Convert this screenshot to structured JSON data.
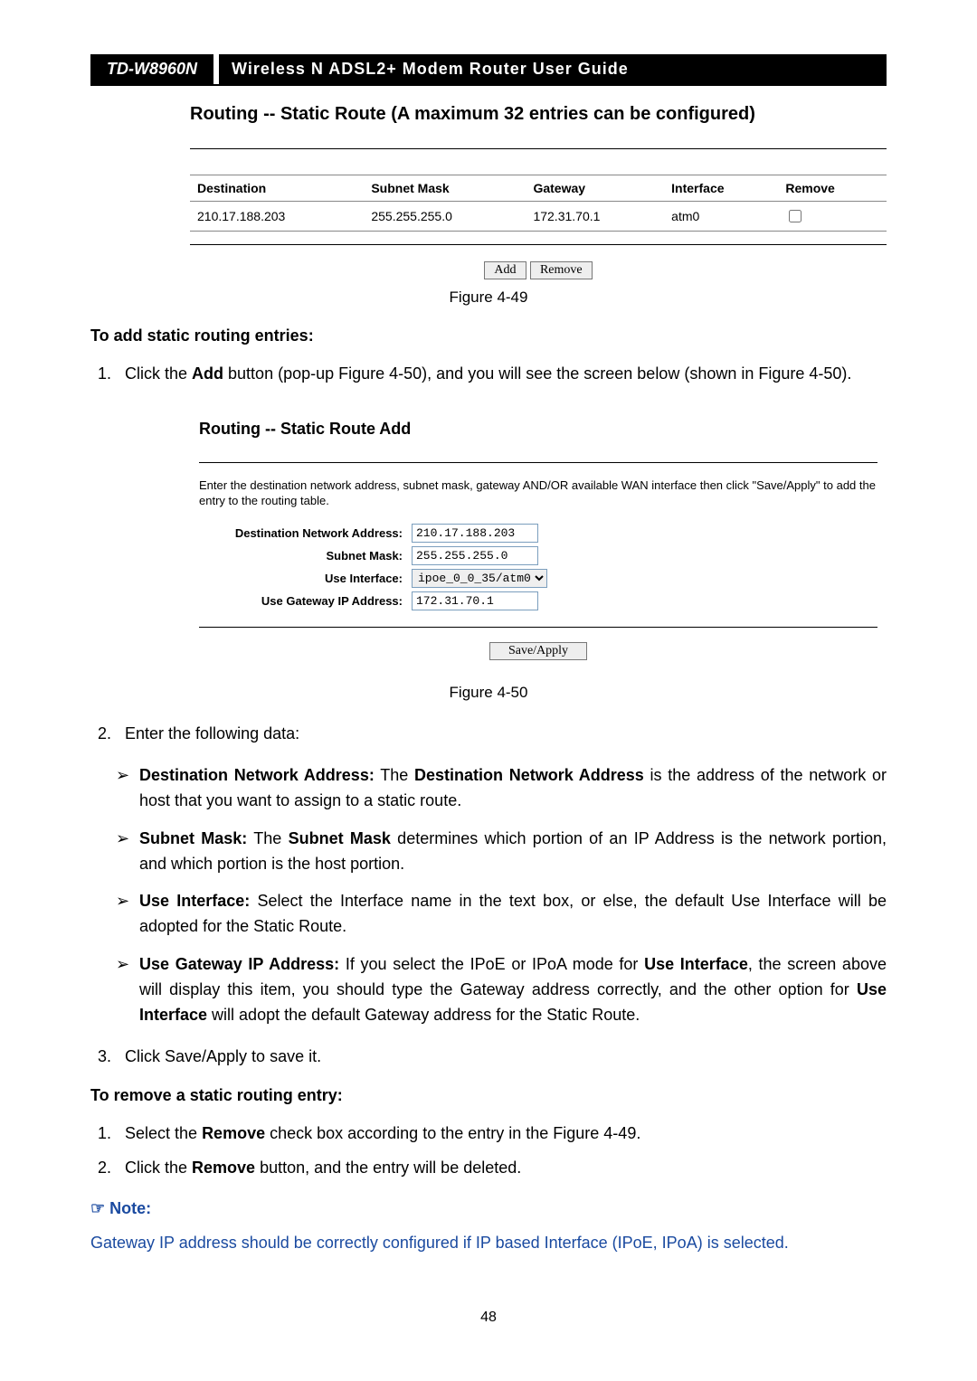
{
  "header": {
    "model": "TD-W8960N",
    "title": "Wireless N ADSL2+ Modem Router User Guide"
  },
  "fig49": {
    "title": "Routing -- Static Route (A maximum 32 entries can be configured)",
    "columns": [
      "Destination",
      "Subnet Mask",
      "Gateway",
      "Interface",
      "Remove"
    ],
    "row": {
      "dest": "210.17.188.203",
      "mask": "255.255.255.0",
      "gw": "172.31.70.1",
      "iface": "atm0"
    },
    "buttons": {
      "add": "Add",
      "remove": "Remove"
    },
    "caption": "Figure 4-49"
  },
  "add_heading": "To add static routing entries:",
  "step1_a": "Click the ",
  "step1_b": "Add",
  "step1_c": " button (pop-up Figure 4-50), and you will see the screen below (shown in Figure 4-50).",
  "fig50": {
    "title": "Routing -- Static Route Add",
    "desc": "Enter the destination network address, subnet mask, gateway AND/OR available WAN interface then click \"Save/Apply\" to add the entry to the routing table.",
    "labels": {
      "dest": "Destination Network Address:",
      "mask": "Subnet Mask:",
      "iface": "Use Interface:",
      "gw": "Use Gateway IP Address:"
    },
    "values": {
      "dest": "210.17.188.203",
      "mask": "255.255.255.0",
      "iface": "ipoe_0_0_35/atm0",
      "gw": "172.31.70.1"
    },
    "save": "Save/Apply",
    "caption": "Figure 4-50"
  },
  "step2": "Enter the following data:",
  "bullets": {
    "b1_a": "Destination Network Address:",
    "b1_b": " The ",
    "b1_c": "Destination Network Address",
    "b1_d": " is the address of the network or host that you want to assign to a static route.",
    "b2_a": "Subnet Mask:",
    "b2_b": " The ",
    "b2_c": "Subnet Mask",
    "b2_d": " determines which portion of an IP Address is the network portion, and which portion is the host portion.",
    "b3_a": "Use Interface:",
    "b3_b": " Select the Interface name in the text box, or else, the default Use Interface will be adopted for the Static Route.",
    "b4_a": "Use Gateway IP Address:",
    "b4_b": "  If you select the IPoE or IPoA mode for ",
    "b4_c": "Use Interface",
    "b4_d": ", the screen above will display this item, you should type the Gateway address correctly, and the other option for ",
    "b4_e": "Use Interface",
    "b4_f": " will adopt the default Gateway address for the Static Route."
  },
  "step3": "Click Save/Apply to save it.",
  "remove_heading": "To remove a static routing entry:",
  "rstep1_a": "Select the ",
  "rstep1_b": "Remove",
  "rstep1_c": " check box according to the entry in the Figure 4-49.",
  "rstep2_a": "Click the ",
  "rstep2_b": "Remove",
  "rstep2_c": " button, and the entry will be deleted.",
  "note_label": "Note:",
  "note_body": "Gateway IP address should be correctly configured if IP based Interface (IPoE, IPoA) is selected.",
  "page_num": "48"
}
